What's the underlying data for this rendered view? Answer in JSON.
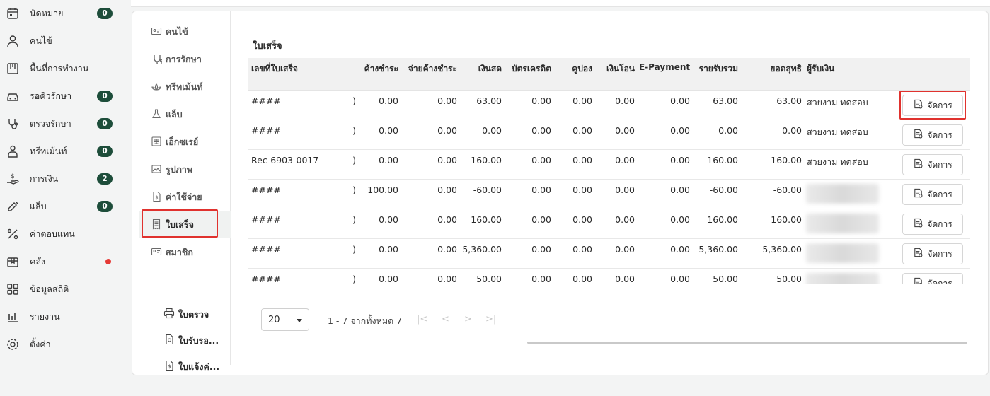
{
  "sidebar": {
    "items": [
      {
        "label": "นัดหมาย",
        "icon": "calendar-icon",
        "badge": "0"
      },
      {
        "label": "คนไข้",
        "icon": "user-icon",
        "badge": ""
      },
      {
        "label": "พื้นที่การทำงาน",
        "icon": "workspace-icon",
        "badge": ""
      },
      {
        "label": "รอคิวรักษา",
        "icon": "car-icon",
        "badge": "0"
      },
      {
        "label": "ตรวจรักษา",
        "icon": "stethoscope-icon",
        "badge": "0"
      },
      {
        "label": "ทรีทเม้นท์",
        "icon": "treatment-icon",
        "badge": "0"
      },
      {
        "label": "การเงิน",
        "icon": "money-hand-icon",
        "badge": "2"
      },
      {
        "label": "แล็บ",
        "icon": "syringe-icon",
        "badge": "0"
      },
      {
        "label": "ค่าตอบแทน",
        "icon": "percent-icon",
        "badge": ""
      },
      {
        "label": "คลัง",
        "icon": "box-icon",
        "badge": ""
      },
      {
        "label": "ข้อมูลสถิติ",
        "icon": "grid-icon",
        "badge": ""
      },
      {
        "label": "รายงาน",
        "icon": "bar-chart-icon",
        "badge": ""
      },
      {
        "label": "ตั้งค่า",
        "icon": "gear-icon",
        "badge": ""
      }
    ],
    "badge_color": "#1d4d3a",
    "alert_dot_color": "#e53935"
  },
  "submenu": {
    "items": [
      {
        "label": "คนไข้",
        "icon": "id-card-icon"
      },
      {
        "label": "การรักษา",
        "icon": "stethoscope-icon"
      },
      {
        "label": "ทรีทเม้นท์",
        "icon": "lotus-icon"
      },
      {
        "label": "แล็บ",
        "icon": "flask-icon"
      },
      {
        "label": "เอ็กซเรย์",
        "icon": "xray-icon"
      },
      {
        "label": "รูปภาพ",
        "icon": "image-icon"
      },
      {
        "label": "ค่าใช้จ่าย",
        "icon": "expense-doc-icon"
      },
      {
        "label": "ใบเสร็จ",
        "icon": "receipt-icon"
      },
      {
        "label": "สมาชิก",
        "icon": "member-card-icon"
      }
    ],
    "active": "ใบเสร็จ",
    "print_items": [
      {
        "label": "ใบตรวจ",
        "icon": "printer-icon"
      },
      {
        "label": "ใบรับรอ...",
        "icon": "certificate-doc-icon"
      },
      {
        "label": "ใบแจ้งค่...",
        "icon": "invoice-doc-icon"
      }
    ]
  },
  "receipts": {
    "title": "ใบเสร็จ",
    "columns": [
      "เลขที่ใบเสร็จ",
      "",
      "ค้างชำระ",
      "จ่ายค้างชำระ",
      "เงินสด",
      "บัตรเครดิต",
      "คูปอง",
      "เงินโอน",
      "E-Payment",
      "รายรับรวม",
      "ยอดสุทธิ",
      "ผู้รับเงิน"
    ],
    "action_label": "จัดการ",
    "rows": [
      {
        "no": "####",
        "trunc": ")",
        "outstanding": "0.00",
        "pay_outstanding": "0.00",
        "cash": "63.00",
        "credit": "0.00",
        "coupon": "0.00",
        "transfer": "0.00",
        "epay": "0.00",
        "total": "63.00",
        "net": "63.00",
        "receiver": "สวยงาม ทดสอบ"
      },
      {
        "no": "####",
        "trunc": ")",
        "outstanding": "0.00",
        "pay_outstanding": "0.00",
        "cash": "0.00",
        "credit": "0.00",
        "coupon": "0.00",
        "transfer": "0.00",
        "epay": "0.00",
        "total": "0.00",
        "net": "0.00",
        "receiver": "สวยงาม ทดสอบ"
      },
      {
        "no": "Rec-6903-0017",
        "trunc": ")",
        "outstanding": "0.00",
        "pay_outstanding": "0.00",
        "cash": "160.00",
        "credit": "0.00",
        "coupon": "0.00",
        "transfer": "0.00",
        "epay": "0.00",
        "total": "160.00",
        "net": "160.00",
        "receiver": "สวยงาม ทดสอบ"
      },
      {
        "no": "####",
        "trunc": ")",
        "outstanding": "100.00",
        "pay_outstanding": "0.00",
        "cash": "-60.00",
        "credit": "0.00",
        "coupon": "0.00",
        "transfer": "0.00",
        "epay": "0.00",
        "total": "-60.00",
        "net": "-60.00",
        "receiver": ""
      },
      {
        "no": "####",
        "trunc": ")",
        "outstanding": "0.00",
        "pay_outstanding": "0.00",
        "cash": "160.00",
        "credit": "0.00",
        "coupon": "0.00",
        "transfer": "0.00",
        "epay": "0.00",
        "total": "160.00",
        "net": "160.00",
        "receiver": ""
      },
      {
        "no": "####",
        "trunc": ")",
        "outstanding": "0.00",
        "pay_outstanding": "0.00",
        "cash": "5,360.00",
        "credit": "0.00",
        "coupon": "0.00",
        "transfer": "0.00",
        "epay": "0.00",
        "total": "5,360.00",
        "net": "5,360.00",
        "receiver": ""
      },
      {
        "no": "####",
        "trunc": ")",
        "outstanding": "0.00",
        "pay_outstanding": "0.00",
        "cash": "50.00",
        "credit": "0.00",
        "coupon": "0.00",
        "transfer": "0.00",
        "epay": "0.00",
        "total": "50.00",
        "net": "50.00",
        "receiver": ""
      }
    ]
  },
  "pagination": {
    "page_size": "20",
    "info": "1 - 7 จากทั้งหมด 7",
    "first": "|<",
    "prev": "<",
    "next": ">",
    "last": ">|"
  },
  "highlight_color": "#e0322e"
}
